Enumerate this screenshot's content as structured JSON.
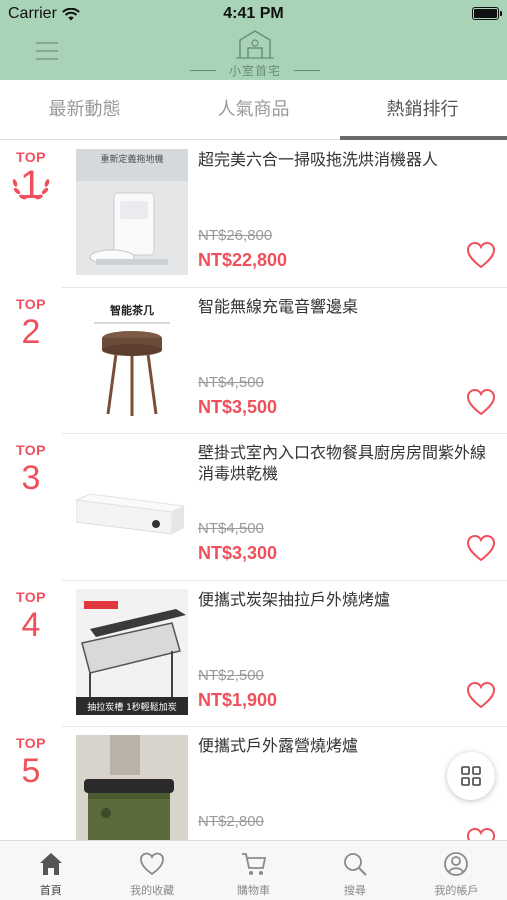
{
  "status_bar": {
    "carrier": "Carrier",
    "time": "4:41 PM"
  },
  "header": {
    "logo_text": "小室首宅"
  },
  "tabs": [
    {
      "label": "最新動態",
      "active": false
    },
    {
      "label": "人氣商品",
      "active": false
    },
    {
      "label": "熱銷排行",
      "active": true
    }
  ],
  "products": [
    {
      "rank_label": "TOP",
      "rank": "1",
      "name": "超完美六合一掃吸拖洗烘消機器人",
      "original_price": "NT$26,800",
      "price": "NT$22,800",
      "image_caption": "重新定義拖地機"
    },
    {
      "rank_label": "TOP",
      "rank": "2",
      "name": "智能無線充電音響邊桌",
      "original_price": "NT$4,500",
      "price": "NT$3,500",
      "image_caption": "智能茶几"
    },
    {
      "rank_label": "TOP",
      "rank": "3",
      "name": "壁掛式室內入口衣物餐具廚房房間紫外線消毒烘乾機",
      "original_price": "NT$4,500",
      "price": "NT$3,300",
      "image_caption": ""
    },
    {
      "rank_label": "TOP",
      "rank": "4",
      "name": "便攜式炭架抽拉戶外燒烤爐",
      "original_price": "NT$2,500",
      "price": "NT$1,900",
      "image_caption": "抽拉炭槽 1秒輕鬆加炭"
    },
    {
      "rank_label": "TOP",
      "rank": "5",
      "name": "便攜式戶外露營燒烤爐",
      "original_price": "NT$2,800",
      "price": "",
      "image_caption": ""
    }
  ],
  "bottom_nav": [
    {
      "label": "首頁",
      "icon": "home-icon",
      "active": true
    },
    {
      "label": "我的收藏",
      "icon": "heart-icon",
      "active": false
    },
    {
      "label": "購物車",
      "icon": "cart-icon",
      "active": false
    },
    {
      "label": "搜尋",
      "icon": "search-icon",
      "active": false
    },
    {
      "label": "我的帳戶",
      "icon": "account-icon",
      "active": false
    }
  ],
  "colors": {
    "header_bg": "#a9d3b6",
    "accent": "#f0505c",
    "muted": "#9a9a9a"
  }
}
